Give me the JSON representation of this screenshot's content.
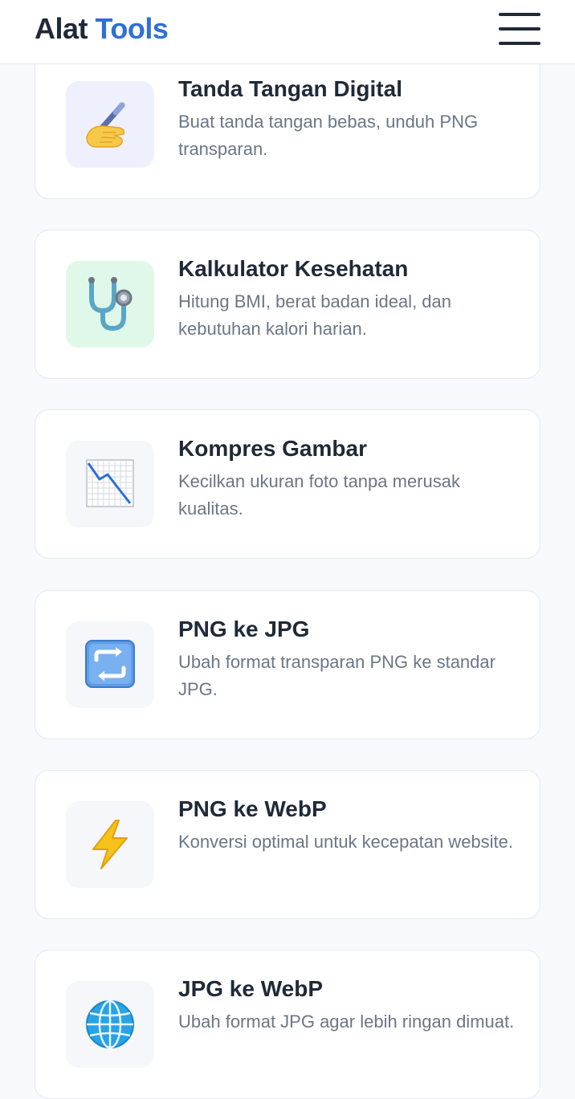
{
  "header": {
    "brand_part1": "Alat",
    "brand_part2": "Tools",
    "menu_icon": "hamburger-menu-icon"
  },
  "tools": [
    {
      "title": "Tanda Tangan Digital",
      "description": "Buat tanda tangan bebas, unduh PNG transparan.",
      "icon": "writing-hand-icon",
      "icon_bg": "#eef1fd"
    },
    {
      "title": "Kalkulator Kesehatan",
      "description": "Hitung BMI, berat badan ideal, dan kebutuhan kalori harian.",
      "icon": "stethoscope-icon",
      "icon_bg": "#e0f8ea"
    },
    {
      "title": "Kompres Gambar",
      "description": "Kecilkan ukuran foto tanpa merusak kualitas.",
      "icon": "chart-decreasing-icon",
      "icon_bg": "#f5f7fa"
    },
    {
      "title": "PNG ke JPG",
      "description": "Ubah format transparan PNG ke standar JPG.",
      "icon": "repeat-arrows-icon",
      "icon_bg": "#f5f7fa"
    },
    {
      "title": "PNG ke WebP",
      "description": "Konversi optimal untuk kecepatan website.",
      "icon": "lightning-bolt-icon",
      "icon_bg": "#f5f7fa"
    },
    {
      "title": "JPG ke WebP",
      "description": "Ubah format JPG agar lebih ringan dimuat.",
      "icon": "globe-icon",
      "icon_bg": "#f5f7fa"
    }
  ]
}
